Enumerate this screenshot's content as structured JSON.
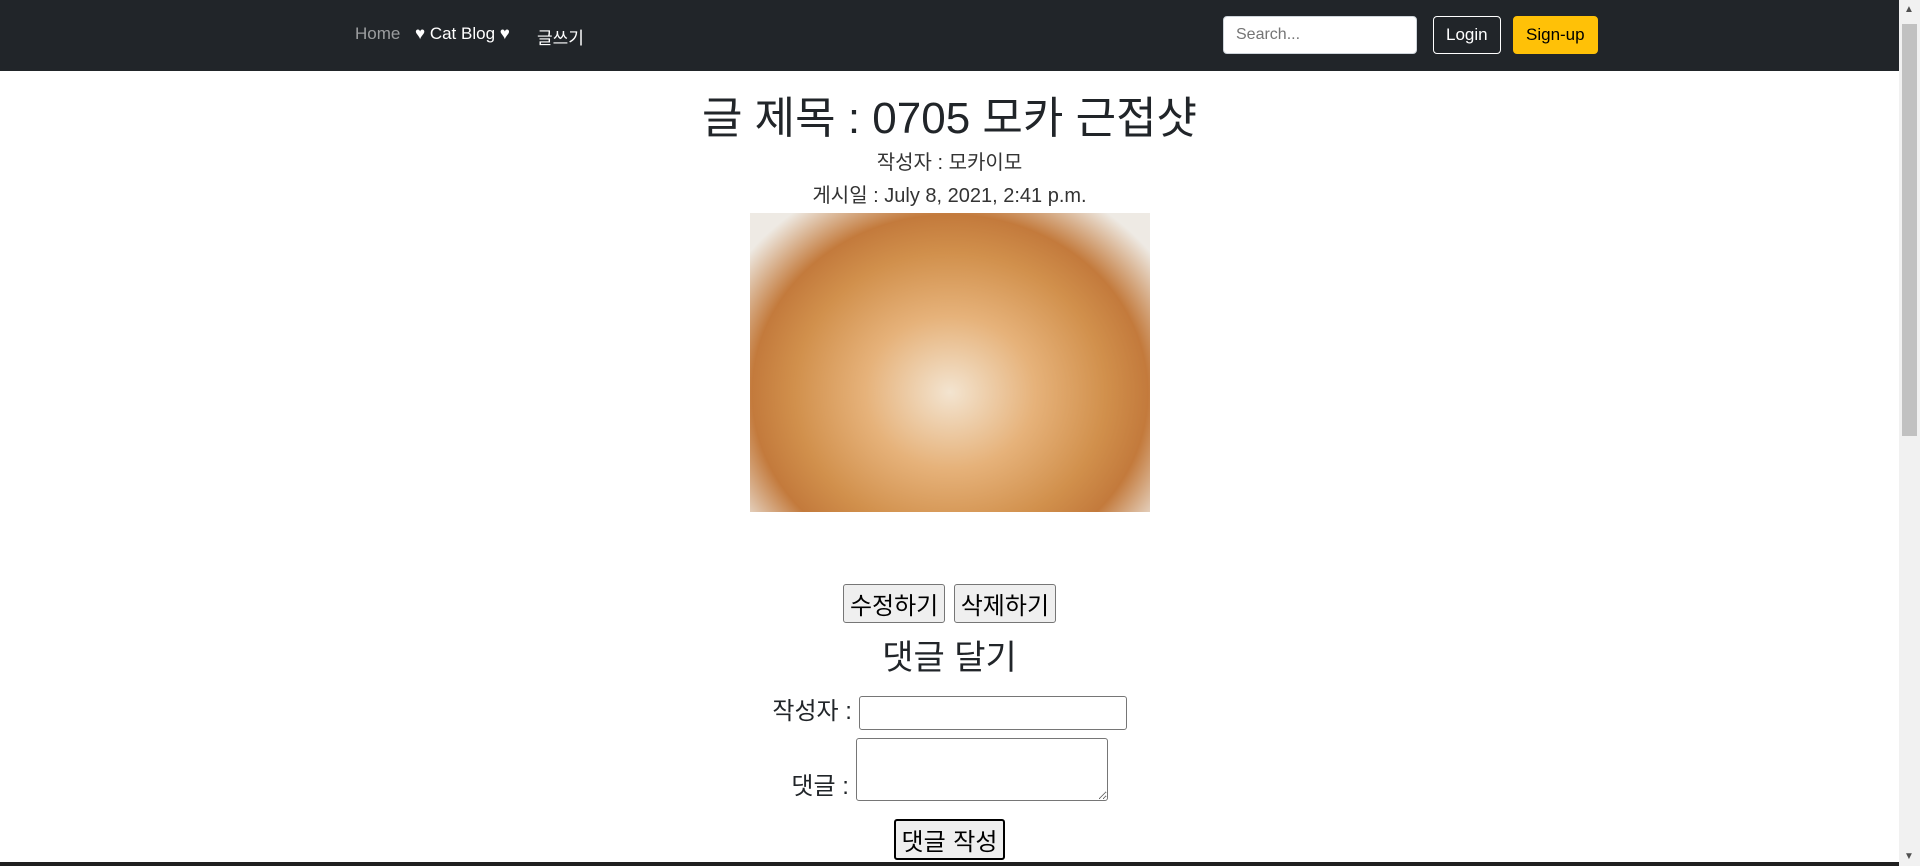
{
  "nav": {
    "home": "Home",
    "brand": "♥ Cat Blog ♥",
    "write": "글쓰기",
    "search_placeholder": "Search...",
    "login": "Login",
    "signup": "Sign-up"
  },
  "post": {
    "title": "글 제목 : 0705 모카 근접샷",
    "author": "작성자 : 모카이모",
    "date": "게시일 : July 8, 2021, 2:41 p.m.",
    "image_alt": "orange kitten close-up",
    "edit": "수정하기",
    "delete": "삭제하기"
  },
  "comment": {
    "heading": "댓글 달기",
    "author_label": "작성자 :",
    "author_value": "",
    "body_label": "댓글 :",
    "body_value": "",
    "submit": "댓글 작성"
  },
  "colors": {
    "navbar": "#212529",
    "signup": "#ffc107"
  }
}
